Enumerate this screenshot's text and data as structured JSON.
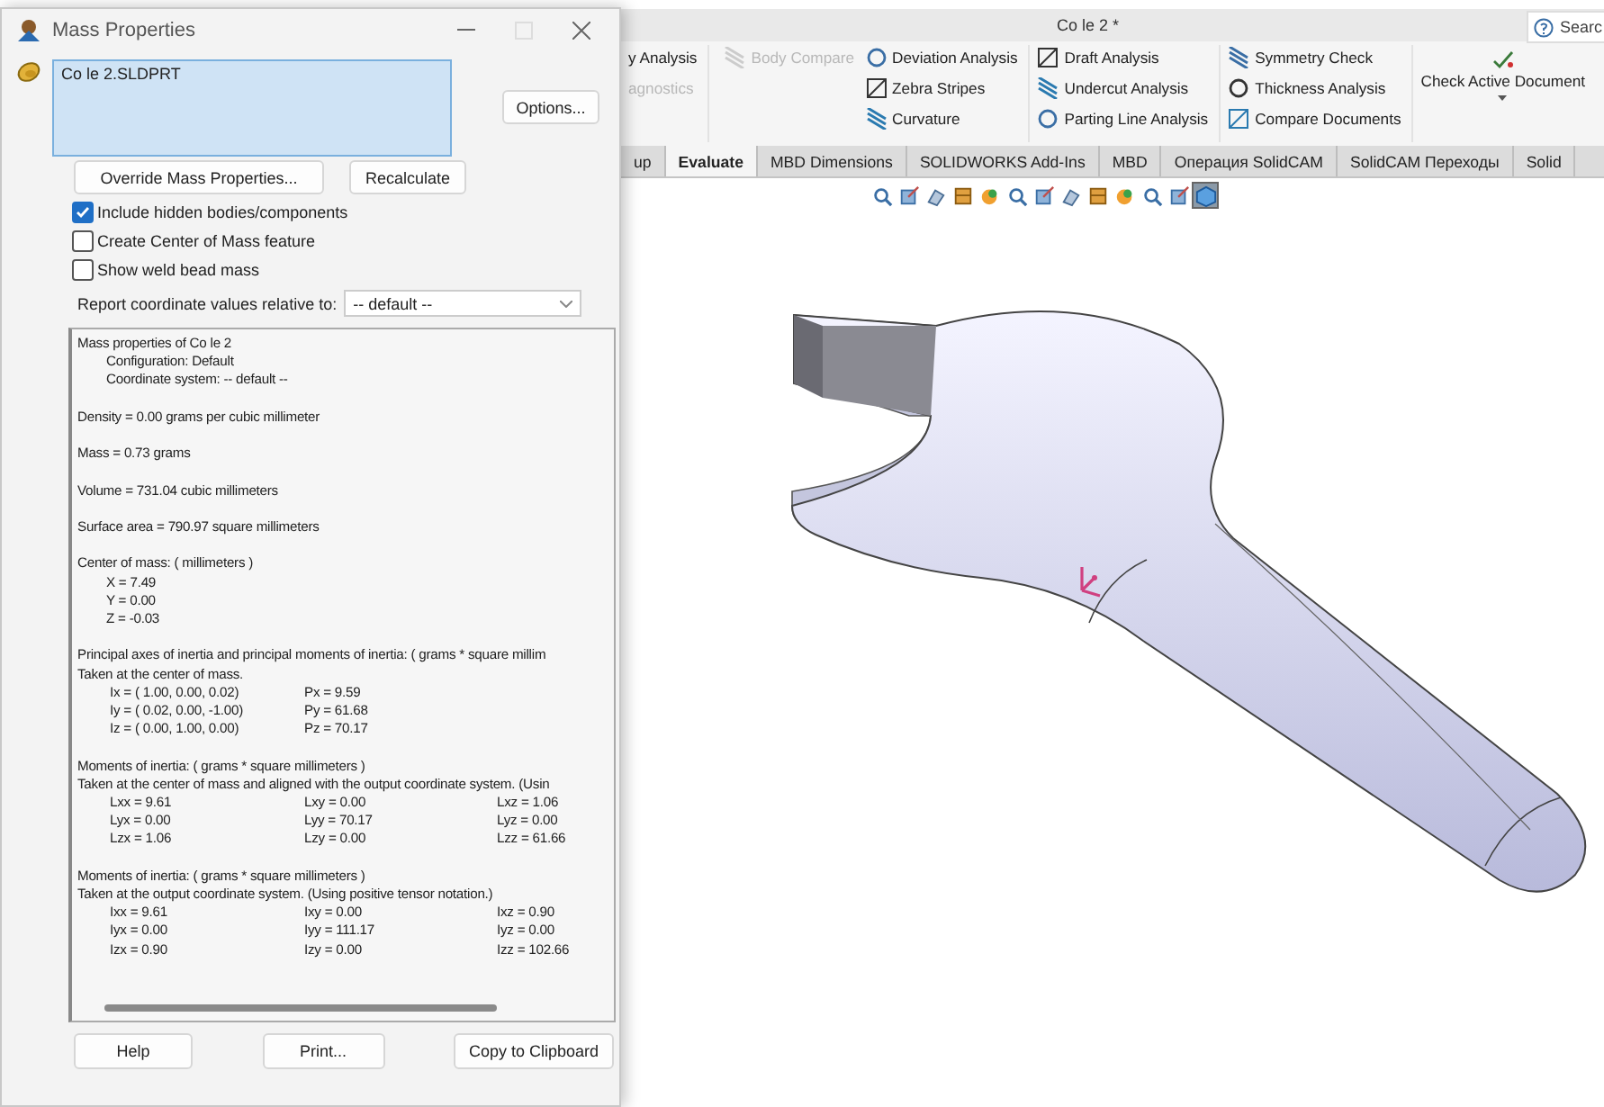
{
  "dialog": {
    "title": "Mass Properties",
    "selection": "Co le 2.SLDPRT",
    "options_button": "Options...",
    "action_buttons": [
      "Override Mass Properties...",
      "Recalculate"
    ],
    "checkboxes": [
      {
        "label": "Include hidden bodies/components",
        "checked": true
      },
      {
        "label": "Create Center of Mass feature",
        "checked": false
      },
      {
        "label": "Show weld bead mass",
        "checked": false
      }
    ],
    "coordinate": {
      "label": "Report coordinate values relative to:",
      "value": "-- default --"
    },
    "report": [
      {
        "lines": [
          {
            "kind": "text",
            "text": "Mass properties of Co le 2"
          },
          {
            "kind": "indent",
            "text": "Configuration: Default"
          },
          {
            "kind": "indent",
            "text": "Coordinate system: -- default --"
          }
        ]
      },
      {
        "lines": [
          {
            "kind": "text",
            "text": "Density = 0.00 grams per cubic millimeter"
          }
        ]
      },
      {
        "lines": [
          {
            "kind": "text",
            "text": "Mass = 0.73 grams"
          }
        ]
      },
      {
        "lines": [
          {
            "kind": "text",
            "text": "Volume = 731.04 cubic millimeters"
          }
        ]
      },
      {
        "lines": [
          {
            "kind": "text",
            "text": "Surface area = 790.97  square millimeters"
          }
        ]
      },
      {
        "lines": [
          {
            "kind": "text",
            "text": "Center of mass: ( millimeters )"
          },
          {
            "kind": "indent",
            "text": "X = 7.49"
          },
          {
            "kind": "indent",
            "text": "Y = 0.00"
          },
          {
            "kind": "indent",
            "text": "Z = -0.03"
          }
        ]
      },
      {
        "lines": [
          {
            "kind": "text",
            "text": "Principal axes of inertia and principal moments of inertia: ( grams *  square millim"
          },
          {
            "kind": "text",
            "text": "Taken at the center of mass."
          },
          {
            "kind": "row",
            "cells": [
              "Ix = ( 1.00,  0.00,  0.02)",
              "Px = 9.59"
            ]
          },
          {
            "kind": "row",
            "cells": [
              "Iy = ( 0.02,  0.00, -1.00)",
              "Py = 61.68"
            ]
          },
          {
            "kind": "row",
            "cells": [
              "Iz = ( 0.00,  1.00,  0.00)",
              "Pz = 70.17"
            ]
          }
        ]
      },
      {
        "lines": [
          {
            "kind": "text",
            "text": "Moments of inertia: ( grams *  square millimeters )"
          },
          {
            "kind": "text",
            "text": "Taken at the center of mass and aligned with the output coordinate system. (Usin"
          },
          {
            "kind": "row",
            "cells": [
              "Lxx = 9.61",
              "Lxy = 0.00",
              "Lxz = 1.06"
            ]
          },
          {
            "kind": "row",
            "cells": [
              "Lyx = 0.00",
              "Lyy = 70.17",
              "Lyz = 0.00"
            ]
          },
          {
            "kind": "row",
            "cells": [
              "Lzx = 1.06",
              "Lzy = 0.00",
              "Lzz = 61.66"
            ]
          }
        ]
      },
      {
        "lines": [
          {
            "kind": "text",
            "text": "Moments of inertia: ( grams *  square millimeters )"
          },
          {
            "kind": "text",
            "text": "Taken at the output coordinate system. (Using positive tensor notation.)"
          },
          {
            "kind": "row",
            "cells": [
              "Ixx = 9.61",
              "Ixy = 0.00",
              "Ixz = 0.90"
            ]
          },
          {
            "kind": "row",
            "cells": [
              "Iyx = 0.00",
              "Iyy = 111.17",
              "Iyz = 0.00"
            ]
          },
          {
            "kind": "row",
            "cells": [
              "Izx = 0.90",
              "Izy = 0.00",
              "Izz = 102.66"
            ]
          }
        ]
      }
    ],
    "footer_buttons": [
      "Help",
      "Print...",
      "Copy to Clipboard"
    ]
  },
  "app": {
    "title": "Co le 2 *",
    "search": {
      "placeholder": "Searc"
    },
    "ribbon": [
      {
        "items": [
          {
            "label": "y Analysis",
            "disabled": false
          },
          {
            "label": "agnostics",
            "disabled": true
          }
        ]
      },
      {
        "items": [
          {
            "label": "Body Compare",
            "disabled": true
          }
        ]
      },
      {
        "items": [
          {
            "label": "Deviation Analysis",
            "disabled": false
          },
          {
            "label": "Zebra Stripes",
            "disabled": false
          },
          {
            "label": "Curvature",
            "disabled": false
          }
        ]
      },
      {
        "items": [
          {
            "label": "Draft Analysis",
            "disabled": false
          },
          {
            "label": "Undercut Analysis",
            "disabled": false
          },
          {
            "label": "Parting Line Analysis",
            "disabled": false
          }
        ]
      },
      {
        "items": [
          {
            "label": "Symmetry Check",
            "disabled": false
          },
          {
            "label": "Thickness Analysis",
            "disabled": false
          },
          {
            "label": "Compare Documents",
            "disabled": false
          }
        ]
      }
    ],
    "check_button": "Check Active Document",
    "tabs": [
      {
        "label": "up",
        "selected": false
      },
      {
        "label": "Evaluate",
        "selected": true
      },
      {
        "label": "MBD Dimensions",
        "selected": false
      },
      {
        "label": "SOLIDWORKS Add-Ins",
        "selected": false
      },
      {
        "label": "MBD",
        "selected": false
      },
      {
        "label": "Операция  SolidCAM",
        "selected": false
      },
      {
        "label": "SolidCAM Переходы",
        "selected": false
      },
      {
        "label": "Solid",
        "selected": false
      }
    ],
    "view_toolbar": [
      {
        "selected": false
      },
      {
        "selected": false
      },
      {
        "selected": false
      },
      {
        "selected": false
      },
      {
        "selected": false
      },
      {
        "selected": false
      },
      {
        "selected": false
      },
      {
        "selected": false
      },
      {
        "selected": false
      },
      {
        "selected": false
      },
      {
        "selected": false
      },
      {
        "selected": false
      },
      {
        "selected": true
      }
    ]
  }
}
